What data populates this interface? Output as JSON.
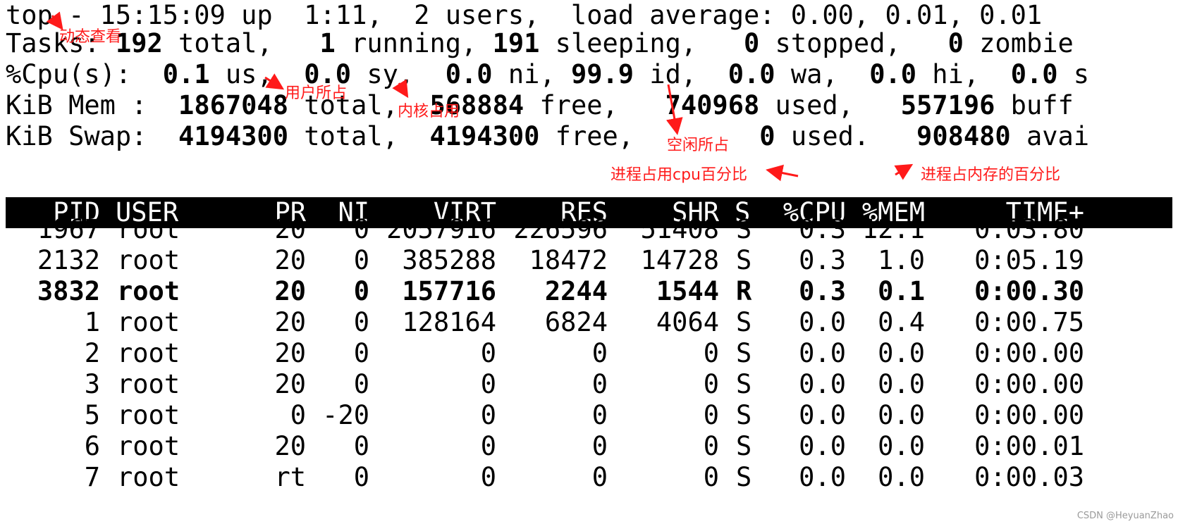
{
  "summary": {
    "line1": "top - 15:15:09 up  1:11,  2 users,  load average: 0.00, 0.01, 0.01",
    "tasks": [
      "Tasks: ",
      "192",
      " total,   ",
      "1",
      " running, ",
      "191",
      " sleeping,   ",
      "0",
      " stopped,   ",
      "0",
      " zombie"
    ],
    "cpu": [
      "%Cpu(s):  ",
      "0.1",
      " us,  ",
      "0.0",
      " sy,  ",
      "0.0",
      " ni, ",
      "99.9",
      " id,  ",
      "0.0",
      " wa,  ",
      "0.0",
      " hi,  ",
      "0.0",
      " s"
    ],
    "mem": [
      "KiB Mem :  ",
      "1867048",
      " total,  ",
      "568884",
      " free,   ",
      "740968",
      " used,   ",
      "557196",
      " buff"
    ],
    "swap": [
      "KiB Swap:  ",
      "4194300",
      " total,  ",
      "4194300",
      " free,        ",
      "0",
      " used.   ",
      "908480",
      " avai"
    ]
  },
  "columns": [
    "PID",
    "USER",
    "PR",
    "NI",
    "VIRT",
    "RES",
    "SHR",
    "S",
    "%CPU",
    "%MEM",
    "TIME+"
  ],
  "processes": [
    {
      "pid": "1967",
      "user": "root",
      "pr": "20",
      "ni": "0",
      "virt": "2057916",
      "res": "226596",
      "shr": "51408",
      "s": "S",
      "cpu": "0.3",
      "mem": "12.1",
      "time": "0:03.80"
    },
    {
      "pid": "2132",
      "user": "root",
      "pr": "20",
      "ni": "0",
      "virt": "385288",
      "res": "18472",
      "shr": "14728",
      "s": "S",
      "cpu": "0.3",
      "mem": "1.0",
      "time": "0:05.19"
    },
    {
      "pid": "3832",
      "user": "root",
      "pr": "20",
      "ni": "0",
      "virt": "157716",
      "res": "2244",
      "shr": "1544",
      "s": "R",
      "cpu": "0.3",
      "mem": "0.1",
      "time": "0:00.30"
    },
    {
      "pid": "1",
      "user": "root",
      "pr": "20",
      "ni": "0",
      "virt": "128164",
      "res": "6824",
      "shr": "4064",
      "s": "S",
      "cpu": "0.0",
      "mem": "0.4",
      "time": "0:00.75"
    },
    {
      "pid": "2",
      "user": "root",
      "pr": "20",
      "ni": "0",
      "virt": "0",
      "res": "0",
      "shr": "0",
      "s": "S",
      "cpu": "0.0",
      "mem": "0.0",
      "time": "0:00.00"
    },
    {
      "pid": "3",
      "user": "root",
      "pr": "20",
      "ni": "0",
      "virt": "0",
      "res": "0",
      "shr": "0",
      "s": "S",
      "cpu": "0.0",
      "mem": "0.0",
      "time": "0:00.00"
    },
    {
      "pid": "5",
      "user": "root",
      "pr": "0",
      "ni": "-20",
      "virt": "0",
      "res": "0",
      "shr": "0",
      "s": "S",
      "cpu": "0.0",
      "mem": "0.0",
      "time": "0:00.00"
    },
    {
      "pid": "6",
      "user": "root",
      "pr": "20",
      "ni": "0",
      "virt": "0",
      "res": "0",
      "shr": "0",
      "s": "S",
      "cpu": "0.0",
      "mem": "0.0",
      "time": "0:00.01"
    },
    {
      "pid": "7",
      "user": "root",
      "pr": "rt",
      "ni": "0",
      "virt": "0",
      "res": "0",
      "shr": "0",
      "s": "S",
      "cpu": "0.0",
      "mem": "0.0",
      "time": "0:00.03"
    }
  ],
  "annotations": {
    "dynamic": "动态查看",
    "user": "用户所占",
    "kernel": "内核占用",
    "idle": "空闲所占",
    "proc_cpu": "进程占用cpu百分比",
    "proc_mem": "进程占内存的百分比",
    "color": "#ff1a1a"
  },
  "watermark": "CSDN @HeyuanZhao"
}
